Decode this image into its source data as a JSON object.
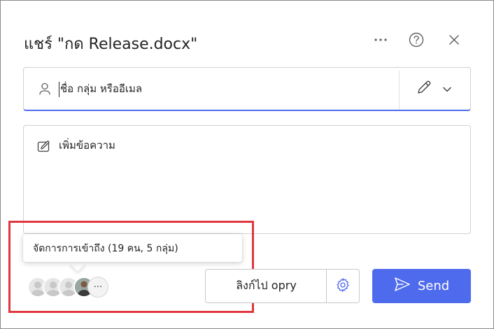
{
  "dialog": {
    "title": "แชร์ \"กด Release.docx\"",
    "more_icon": "more-horizontal-icon",
    "help_icon": "question-circle-icon",
    "close_icon": "close-icon"
  },
  "to_field": {
    "placeholder": "ชื่อ กลุ่ม หรืออีเมล",
    "person_icon": "person-icon",
    "permission_icon": "pencil-icon",
    "chevron_icon": "chevron-down-icon"
  },
  "message": {
    "placeholder": "เพิ่มข้อความ",
    "icon": "compose-icon"
  },
  "access": {
    "tooltip": "จัดการการเข้าถึง (19 คน, 5 กลุ่ม)",
    "more_label": "···"
  },
  "footer": {
    "link_label": "ลิงก์ไป opry",
    "settings_icon": "gear-icon",
    "send_label": "Send",
    "send_icon": "send-icon"
  },
  "colors": {
    "accent": "#4f6bed",
    "highlight": "#e0383e"
  }
}
